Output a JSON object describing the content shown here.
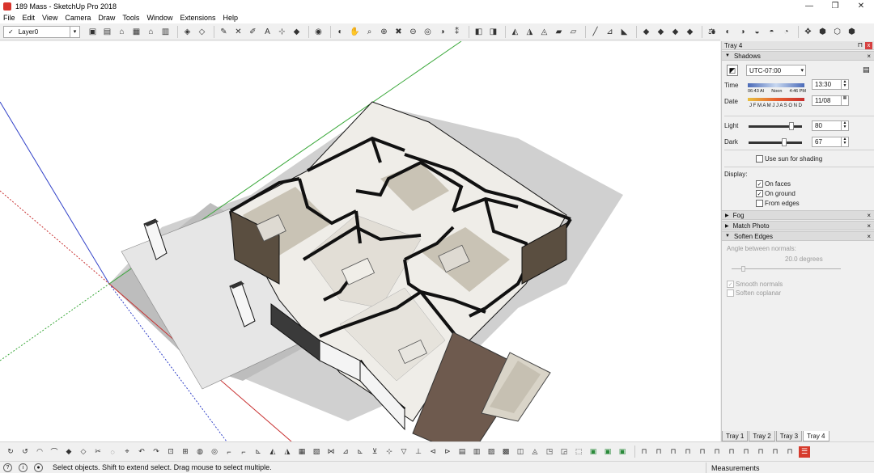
{
  "window": {
    "title": "189 Mass - SketchUp Pro 2018",
    "controls": {
      "minimize": "—",
      "restore": "❐",
      "close": "✕"
    }
  },
  "menu": [
    "File",
    "Edit",
    "View",
    "Camera",
    "Draw",
    "Tools",
    "Window",
    "Extensions",
    "Help"
  ],
  "layer": {
    "check": "✓",
    "name": "Layer0",
    "dropdown": "▾"
  },
  "tray": {
    "title": "Tray 4",
    "pin": "⊓",
    "close": "x",
    "shadows": {
      "header": "Shadows",
      "timezone": "UTC-07:00",
      "time_label": "Time",
      "time_marks": [
        "06:43 AI",
        "Noon",
        "4:46 PM"
      ],
      "time_value": "13:30",
      "date_label": "Date",
      "months": "J F M A M J J A S O N D",
      "date_value": "11/08",
      "light_label": "Light",
      "light_value": "80",
      "light_level": 0.8,
      "dark_label": "Dark",
      "dark_value": "67",
      "dark_level": 0.67,
      "use_sun": "Use sun for shading",
      "display_label": "Display:",
      "on_faces": "On faces",
      "on_ground": "On ground",
      "from_edges": "From edges"
    },
    "fog": {
      "header": "Fog"
    },
    "match_photo": {
      "header": "Match Photo"
    },
    "soften_edges": {
      "header": "Soften Edges",
      "angle_label": "Angle between normals:",
      "angle_value": "20.0  degrees",
      "smooth_normals": "Smooth normals",
      "soften_coplanar": "Soften coplanar"
    },
    "tabs": [
      "Tray 1",
      "Tray 2",
      "Tray 3",
      "Tray 4"
    ]
  },
  "status": {
    "message": "Select objects. Shift to extend select. Drag mouse to select multiple.",
    "measurements_label": "Measurements"
  },
  "colors": {
    "axis_red": "#c83030",
    "axis_green": "#3aa83a",
    "axis_blue": "#3040c8",
    "wall": "#111111",
    "floor_tile": "#e4e1da",
    "wood_deck": "#6e5a4e",
    "shadow": "#c8c8c8"
  }
}
